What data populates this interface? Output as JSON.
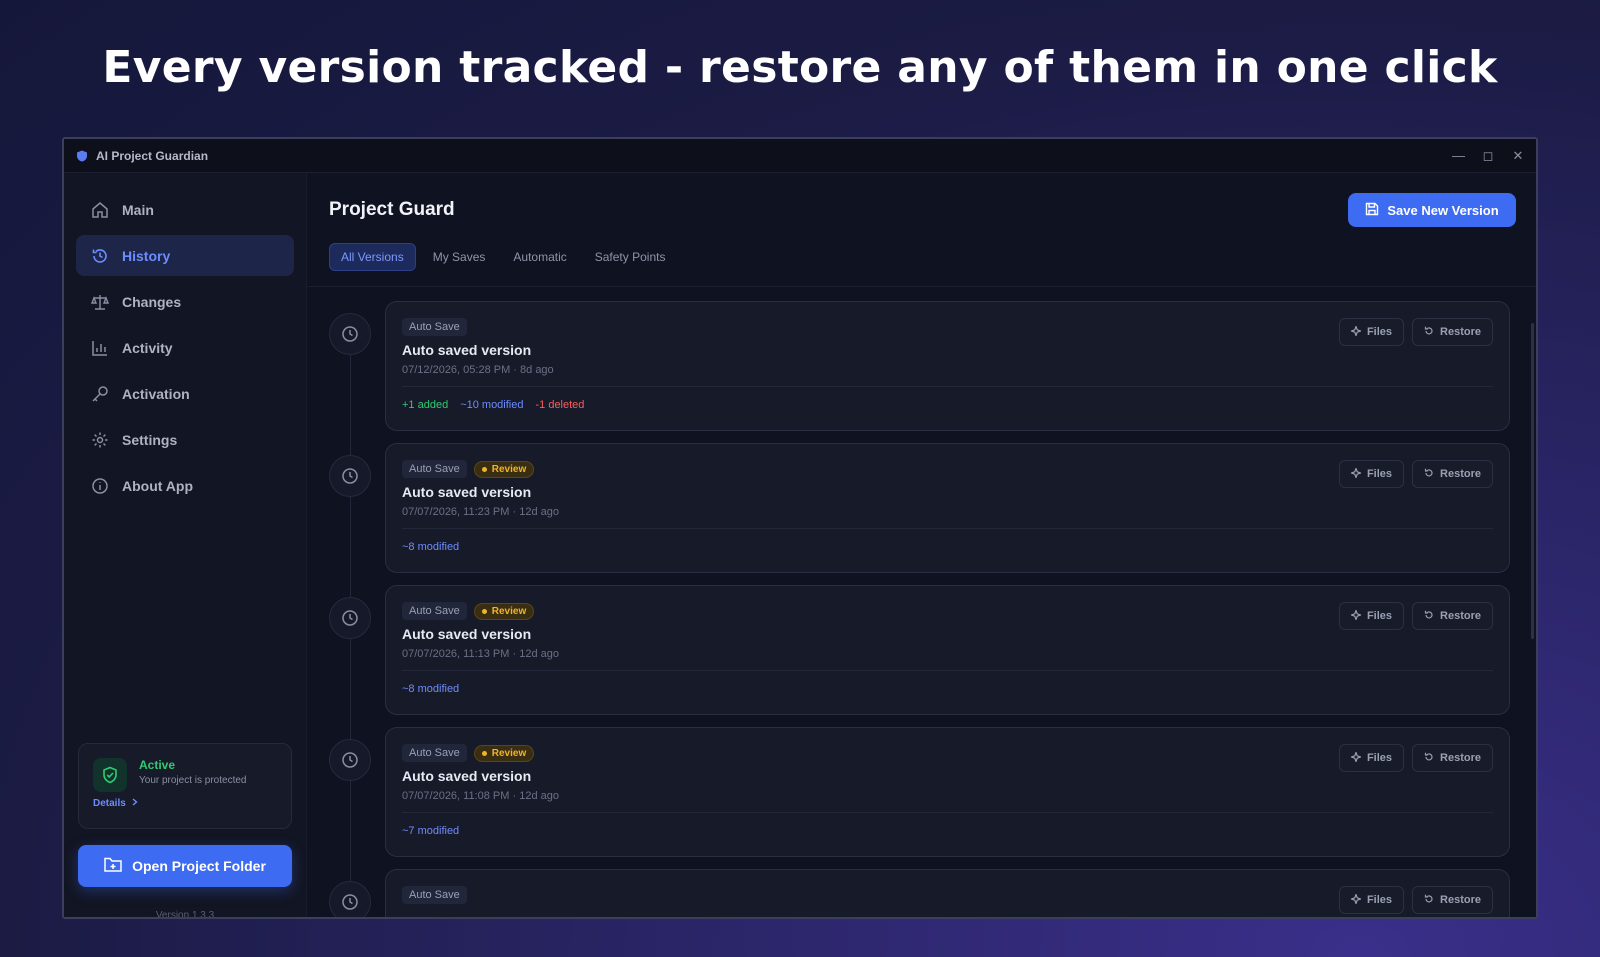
{
  "headline": "Every version tracked - restore any of them in one click",
  "window": {
    "title": "AI Project Guardian",
    "controls": [
      "minimize-icon",
      "maximize-icon",
      "close-icon"
    ]
  },
  "sidebar": {
    "items": [
      {
        "label": "Main",
        "icon": "home-icon",
        "active": false
      },
      {
        "label": "History",
        "icon": "history-icon",
        "active": true
      },
      {
        "label": "Changes",
        "icon": "scale-icon",
        "active": false
      },
      {
        "label": "Activity",
        "icon": "bar-chart-icon",
        "active": false
      },
      {
        "label": "Activation",
        "icon": "key-icon",
        "active": false
      },
      {
        "label": "Settings",
        "icon": "gear-icon",
        "active": false
      },
      {
        "label": "About App",
        "icon": "info-icon",
        "active": false
      }
    ],
    "status": {
      "title": "Active",
      "subtitle": "Your project is protected",
      "details": "Details"
    },
    "open_folder": "Open Project Folder",
    "version": "Version 1.3.3"
  },
  "main": {
    "title": "Project Guard",
    "save_button": "Save New Version",
    "tabs": [
      {
        "label": "All Versions",
        "active": true
      },
      {
        "label": "My Saves",
        "active": false
      },
      {
        "label": "Automatic",
        "active": false
      },
      {
        "label": "Safety Points",
        "active": false
      }
    ],
    "entries": [
      {
        "badge": "Auto Save",
        "review": null,
        "title": "Auto saved version",
        "date": "07/12/2026, 05:28 PM · 8d ago",
        "added": "+1 added",
        "modified": "~10 modified",
        "deleted": "-1 deleted",
        "files": "Files",
        "restore": "Restore"
      },
      {
        "badge": "Auto Save",
        "review": "Review",
        "title": "Auto saved version",
        "date": "07/07/2026, 11:23 PM · 12d ago",
        "added": null,
        "modified": "~8 modified",
        "deleted": null,
        "files": "Files",
        "restore": "Restore"
      },
      {
        "badge": "Auto Save",
        "review": "Review",
        "title": "Auto saved version",
        "date": "07/07/2026, 11:13 PM · 12d ago",
        "added": null,
        "modified": "~8 modified",
        "deleted": null,
        "files": "Files",
        "restore": "Restore"
      },
      {
        "badge": "Auto Save",
        "review": "Review",
        "title": "Auto saved version",
        "date": "07/07/2026, 11:08 PM · 12d ago",
        "added": null,
        "modified": "~7 modified",
        "deleted": null,
        "files": "Files",
        "restore": "Restore"
      },
      {
        "badge": "Auto Save",
        "review": null,
        "title": "",
        "date": "",
        "added": null,
        "modified": null,
        "deleted": null,
        "files": "Files",
        "restore": "Restore"
      }
    ]
  },
  "colors": {
    "accent": "#3d6bf2",
    "added": "#2ecc71",
    "modified": "#6d8cff",
    "deleted": "#ff5c5c",
    "review": "#f0b429"
  }
}
